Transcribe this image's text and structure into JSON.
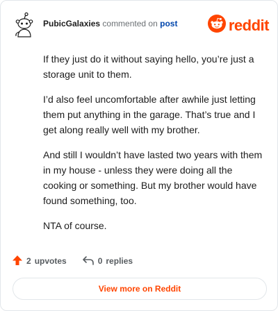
{
  "comment": {
    "author": "PubicGalaxies",
    "action_text": "commented on",
    "post_link_text": "post",
    "paragraphs": [
      "If they just do it without saying hello, you’re just a storage unit to them.",
      "I’d also feel uncomfortable after awhile just letting them put anything in the garage. That’s true and I get along really well with my brother.",
      "And still I wouldn’t have lasted two years with them in my house - unless they were doing all the cooking or something. But my brother would have found something, too.",
      "NTA of course."
    ]
  },
  "brand": {
    "wordmark": "reddit",
    "icon": "reddit-snoo-icon",
    "color": "#ff4500"
  },
  "footer": {
    "upvotes_count": "2",
    "upvotes_label": "upvotes",
    "replies_count": "0",
    "replies_label": "replies",
    "view_more_label": "View more on Reddit"
  },
  "icons": {
    "avatar": "snoo-avatar-icon",
    "upvote": "upvote-arrow-icon",
    "reply": "reply-arrow-icon"
  },
  "colors": {
    "accent": "#ff4500",
    "link": "#0045ac",
    "muted": "#6a6f73"
  }
}
